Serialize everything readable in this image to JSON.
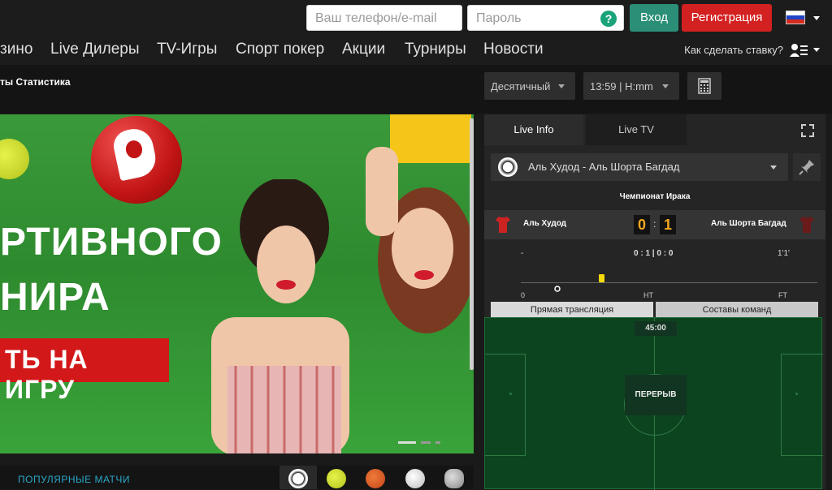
{
  "header": {
    "phone_placeholder": "Ваш телефон/e-mail",
    "password_placeholder": "Пароль",
    "help_glyph": "?",
    "login_label": "Вход",
    "register_label": "Регистрация",
    "login_color": "#2a8f76",
    "register_color": "#d32020"
  },
  "nav": {
    "items": [
      "зино",
      "Live Дилеры",
      "TV-Игры",
      "Спорт покер",
      "Акции",
      "Турниры",
      "Новости"
    ],
    "how_to_bet": "Как сделать ставку?"
  },
  "subbar": {
    "breadcrumb": "ты  Статистика",
    "odds_format": "Десятичный",
    "time_format": "13:59 | H:mm"
  },
  "banner": {
    "line1": "РТИВНОГО",
    "line2": "НИРА",
    "cta": "ТЬ НА ИГРУ"
  },
  "bottom": {
    "popular_label": "ПОПУЛЯРНЫЕ МАТЧИ",
    "sports_icons": [
      "soccer-ball-icon",
      "tennis-ball-icon",
      "basketball-icon",
      "volleyball-icon",
      "hockey-puck-icon"
    ]
  },
  "panel": {
    "tab_live_info": "Live Info",
    "tab_live_tv": "Live TV",
    "match_select": "Аль Худод - Аль Шорта Багдад",
    "league": "Чемпионат Ирака",
    "home_team": "Аль Худод",
    "away_team": "Аль Шорта Багдад",
    "home_score": "0",
    "score_sep": ":",
    "away_score": "1",
    "stat_left": "-",
    "stat_mid": "0 : 1 | 0 : 0",
    "stat_right": "1'1'",
    "timeline_start": "0",
    "timeline_ht": "HT",
    "timeline_ft": "FT",
    "yellow_card_minute_fraction": 0.27,
    "subtab_live": "Прямая трансляция",
    "subtab_lineups": "Составы команд",
    "match_time": "45:00",
    "status": "ПЕРЕРЫВ",
    "home_color": "#cc2222",
    "away_color": "#6a1a1a"
  }
}
